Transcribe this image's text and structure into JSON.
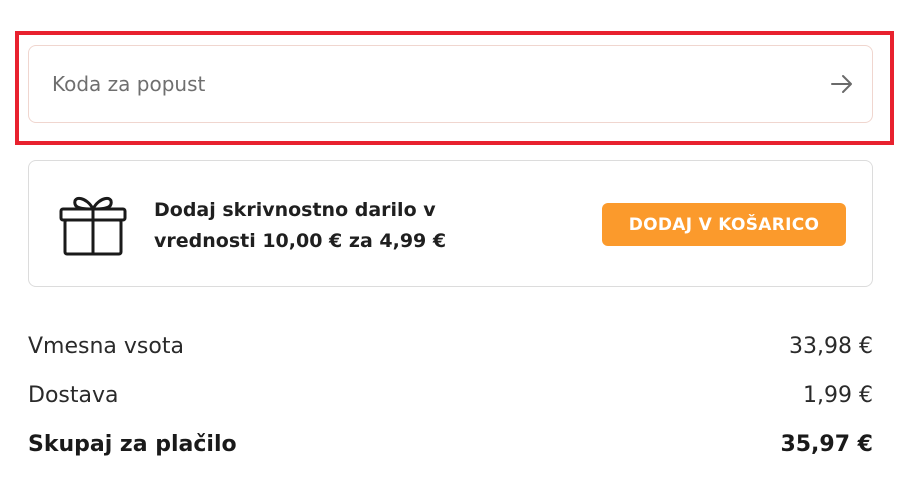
{
  "discount": {
    "placeholder": "Koda za popust",
    "value": "",
    "submit_icon": "arrow-right-icon"
  },
  "gift_offer": {
    "icon": "gift-icon",
    "line1": "Dodaj skrivnostno darilo v",
    "line2": "vrednosti 10,00 € za 4,99 €",
    "button_label": "DODAJ V KOŠARICO",
    "button_color": "#fb9a2c"
  },
  "summary": {
    "subtotal_label": "Vmesna vsota",
    "subtotal_value": "33,98 €",
    "shipping_label": "Dostava",
    "shipping_value": "1,99 €",
    "total_label": "Skupaj za plačilo",
    "total_value": "35,97 €"
  },
  "highlight_color": "#e8212e"
}
